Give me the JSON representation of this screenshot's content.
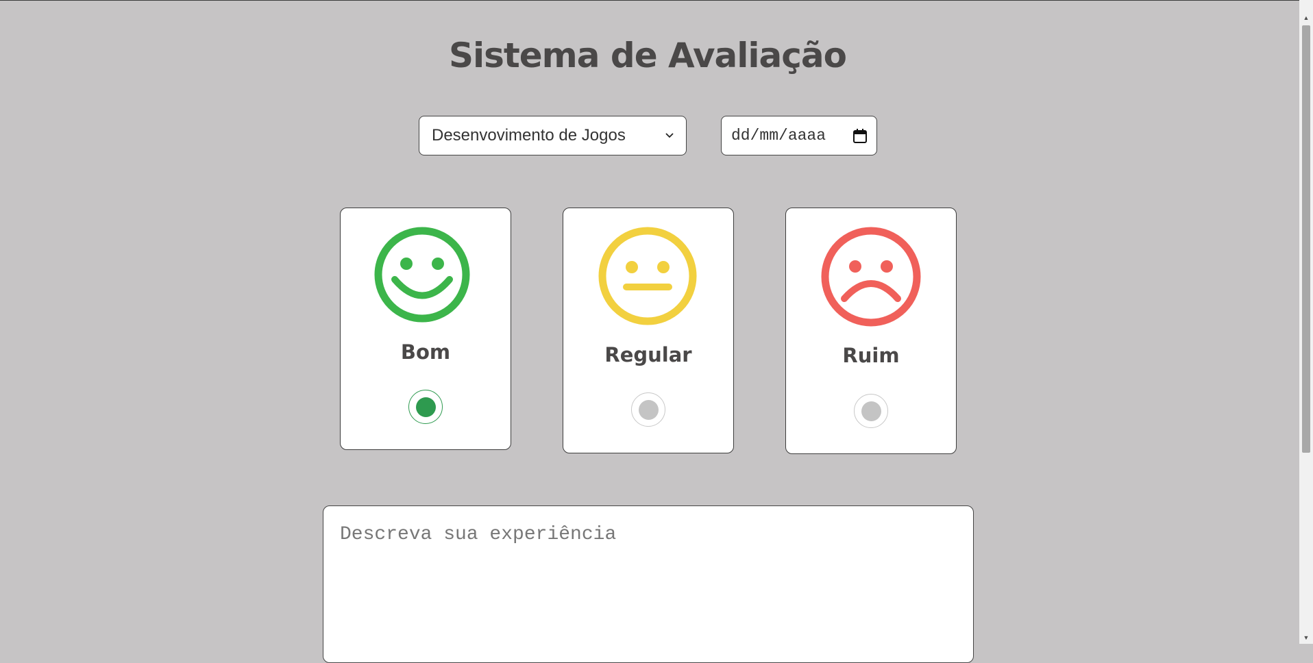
{
  "page": {
    "title": "Sistema de Avaliação"
  },
  "form": {
    "course_select": {
      "selected": "Desenvovimento de Jogos"
    },
    "date_field": {
      "placeholder": "dd/mm/aaaa"
    },
    "ratings": [
      {
        "label": "Bom",
        "color": "#3cb54a",
        "selected": true
      },
      {
        "label": "Regular",
        "color": "#f2d03f",
        "selected": false
      },
      {
        "label": "Ruim",
        "color": "#f0605a",
        "selected": false
      }
    ],
    "description": {
      "placeholder": "Descreva sua experiência"
    }
  },
  "colors": {
    "background": "#c6c4c5",
    "title": "#4a4848",
    "radio_selected": "#2e9a4f",
    "radio_unselected": "#c4c4c4"
  },
  "icons": {
    "select_arrow": "chevron-down-icon",
    "date_picker": "calendar-icon"
  }
}
